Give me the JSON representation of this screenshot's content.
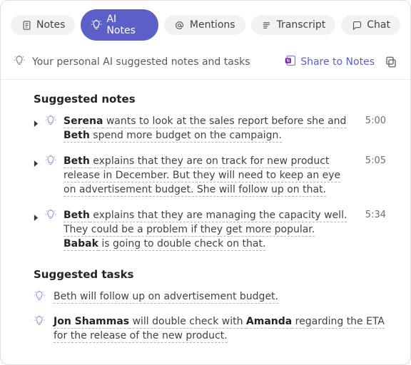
{
  "tabs": [
    {
      "id": "notes",
      "label": "Notes",
      "icon": "note-icon",
      "active": false
    },
    {
      "id": "ai-notes",
      "label": "AI Notes",
      "icon": "bulb-icon",
      "active": true
    },
    {
      "id": "mentions",
      "label": "Mentions",
      "icon": "at-icon",
      "active": false
    },
    {
      "id": "transcript",
      "label": "Transcript",
      "icon": "lines-icon",
      "active": false
    },
    {
      "id": "chat",
      "label": "Chat",
      "icon": "chat-icon",
      "active": false
    }
  ],
  "subtitle": "Your personal AI suggested notes and tasks",
  "share": {
    "label": "Share to Notes"
  },
  "sections": {
    "notes_header": "Suggested notes",
    "tasks_header": "Suggested tasks"
  },
  "notes": [
    {
      "time": "5:00",
      "segments": [
        {
          "t": "Serena",
          "b": true,
          "u": true
        },
        {
          "t": " wants to look at the sales report before she and ",
          "u": true
        },
        {
          "t": "Beth",
          "b": true,
          "u": true
        },
        {
          "t": " spend more budget on the campaign.",
          "u": true
        }
      ]
    },
    {
      "time": "5:05",
      "segments": [
        {
          "t": "Beth",
          "b": true,
          "u": true
        },
        {
          "t": " explains that they are on track for new product release in December. But they will need to keep an eye on advertisement budget. She will follow up on that.",
          "u": true
        }
      ]
    },
    {
      "time": "5:34",
      "segments": [
        {
          "t": "Beth",
          "b": true,
          "u": true
        },
        {
          "t": " explains that they are managing the capacity well. They could be a problem if they get more popular. ",
          "u": true
        },
        {
          "t": "Babak",
          "b": true,
          "u": true
        },
        {
          "t": " is going to double check on that.",
          "u": true
        }
      ]
    }
  ],
  "tasks": [
    {
      "segments": [
        {
          "t": "Beth will follow up on advertisement budget.",
          "u": true
        }
      ]
    },
    {
      "segments": [
        {
          "t": "Jon Shammas",
          "b": true,
          "u": true
        },
        {
          "t": " will double check with ",
          "u": true
        },
        {
          "t": "Amanda",
          "b": true,
          "u": true
        },
        {
          "t": " regarding the ETA for the release of the new product.",
          "u": true
        }
      ]
    }
  ]
}
